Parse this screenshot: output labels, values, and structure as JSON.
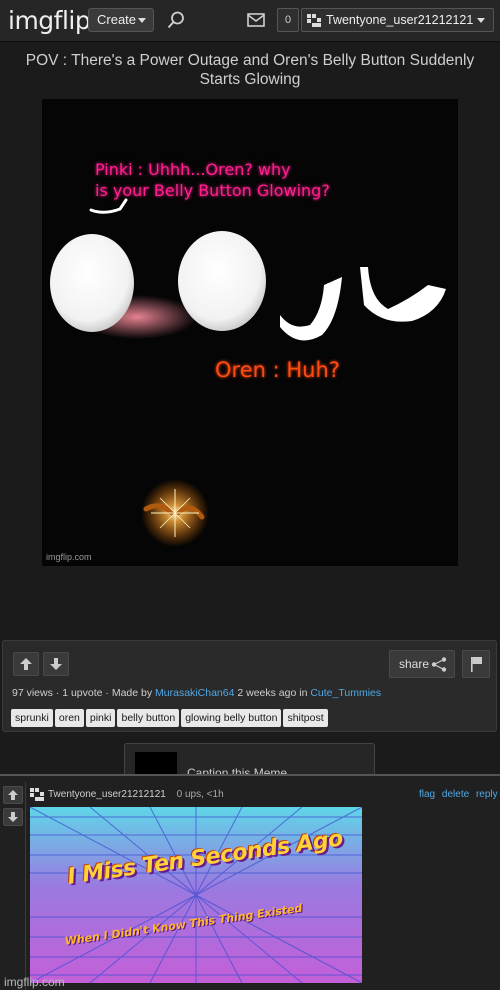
{
  "nav": {
    "logo_img": "img",
    "logo_flip": "flip",
    "create_label": "Create",
    "notif_count": "0",
    "username": "Twentyone_user21212121",
    "icons": [
      "search-icon",
      "mail-icon",
      "avatar-icon",
      "chevron-down-icon"
    ]
  },
  "post": {
    "title": "POV : There's a Power Outage and Oren's Belly Button Suddenly Starts Glowing",
    "meme_text_pinki_line1": "Pinki : Uhhh...Oren? why",
    "meme_text_pinki_line2": "is your Belly Button Glowing?",
    "meme_text_oren": "Oren : Huh?",
    "watermark": "imgflip.com"
  },
  "details": {
    "share_label": "share",
    "views": "97 views",
    "upvotes": "1 upvote",
    "made_by_prefix": "Made by",
    "author": "MurasakiChan64",
    "time_prefix": "2 weeks ago in",
    "stream": "Cute_Tummies",
    "tags": [
      "sprunki",
      "oren",
      "pinki",
      "belly button",
      "glowing belly button",
      "shitpost"
    ]
  },
  "caption": {
    "label": "Caption this Meme"
  },
  "comment": {
    "username": "Twentyone_user21212121",
    "stats": "0 ups, <1h",
    "flag": "flag",
    "delete": "delete",
    "reply": "reply",
    "image_line1": "I Miss Ten Seconds Ago",
    "image_line2": "When I Didn't Know This Thing Existed"
  },
  "footer": {
    "watermark": "imgflip.com"
  },
  "colors": {
    "pinki_text": "#ff1f8e",
    "oren_text": "#ff4a12",
    "link": "#4fa8e6",
    "background": "#1b1b1b"
  }
}
